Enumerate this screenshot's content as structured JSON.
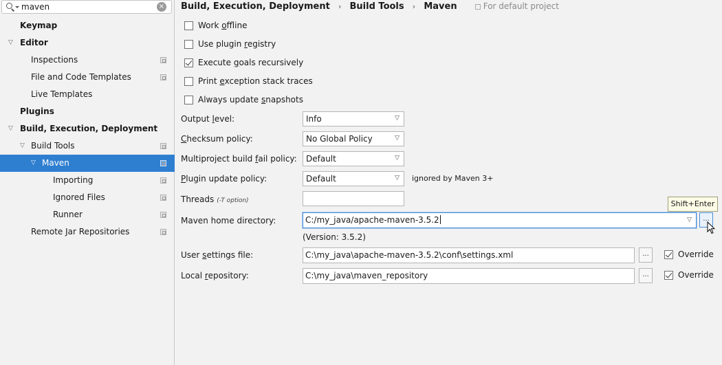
{
  "sidebar": {
    "search": {
      "value": "maven",
      "clear_glyph": "×"
    },
    "items": [
      {
        "label": "Keymap"
      },
      {
        "label": "Editor"
      },
      {
        "label": "Inspections"
      },
      {
        "label": "File and Code Templates"
      },
      {
        "label": "Live Templates"
      },
      {
        "label": "Plugins"
      },
      {
        "label": "Build, Execution, Deployment"
      },
      {
        "label": "Build Tools"
      },
      {
        "label": "Maven"
      },
      {
        "label": "Importing"
      },
      {
        "label": "Ignored Files"
      },
      {
        "label": "Runner"
      },
      {
        "label": "Remote Jar Repositories"
      }
    ]
  },
  "breadcrumb": {
    "parts": [
      "Build, Execution, Deployment",
      "Build Tools",
      "Maven"
    ],
    "separator": "›",
    "scope": "For default project"
  },
  "checkboxes": [
    {
      "pre": "Work ",
      "mn": "o",
      "post": "ffline",
      "checked": false
    },
    {
      "pre": "Use plugin ",
      "mn": "r",
      "post": "egistry",
      "checked": false
    },
    {
      "pre": "Execute ",
      "mn": "g",
      "post": "oals recursively",
      "checked": true
    },
    {
      "pre": "Print ",
      "mn": "e",
      "post": "xception stack traces",
      "checked": false
    },
    {
      "pre": "Always update ",
      "mn": "s",
      "post": "napshots",
      "checked": false
    }
  ],
  "fields": {
    "output_level": {
      "pre": "Output ",
      "mn": "l",
      "post": "evel:",
      "value": "Info"
    },
    "checksum_policy": {
      "pre": "",
      "mn": "C",
      "post": "hecksum policy:",
      "value": "No Global Policy"
    },
    "multiproject": {
      "pre": "Multiproject build ",
      "mn": "f",
      "post": "ail policy:",
      "value": "Default"
    },
    "plugin_update": {
      "pre": "",
      "mn": "P",
      "post": "lugin update policy:",
      "value": "Default",
      "note": "ignored by Maven 3+"
    },
    "threads": {
      "label": "Threads",
      "hint": "(-T option)",
      "value": ""
    },
    "maven_home": {
      "label": "Maven home directory:",
      "value": "C:/my_java/apache-maven-3.5.2",
      "version": "(Version: 3.5.2)"
    },
    "user_settings": {
      "pre": "User ",
      "mn": "s",
      "post": "ettings file:",
      "value": "C:\\my_java\\apache-maven-3.5.2\\conf\\settings.xml",
      "override_label": "Override",
      "override_checked": true
    },
    "local_repo": {
      "pre": "Local ",
      "mn": "r",
      "post": "epository:",
      "value": "C:\\my_java\\maven_repository",
      "override_label": "Override",
      "override_checked": true
    }
  },
  "browse_label": "...",
  "tooltip": "Shift+Enter",
  "colors": {
    "selection": "#2f7fd1",
    "focus": "#4a8ed6",
    "background": "#f2f2f2"
  }
}
